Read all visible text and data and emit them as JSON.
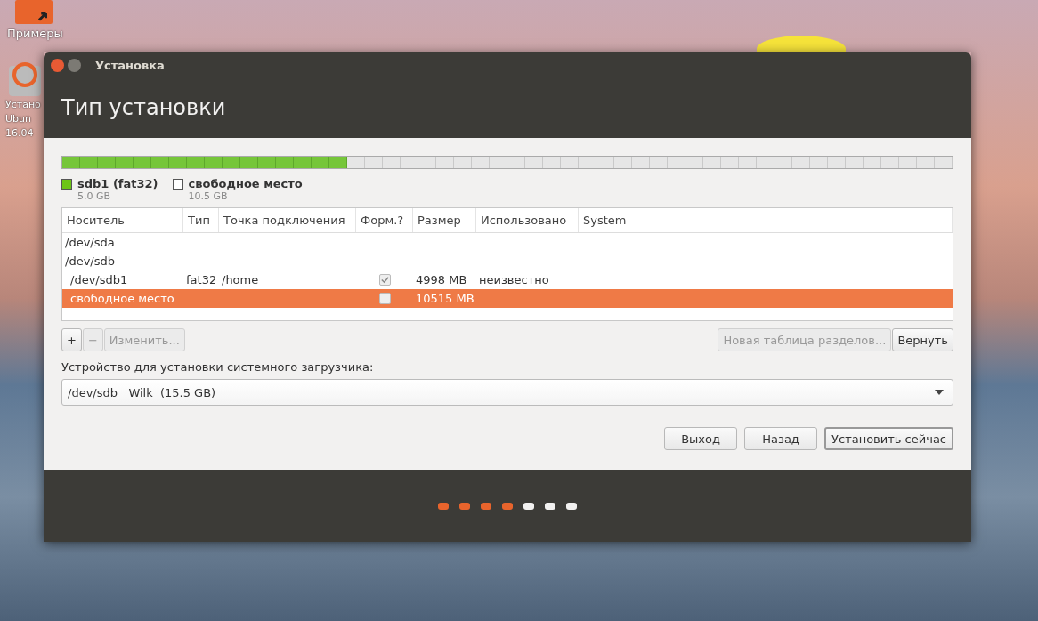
{
  "desktop_icons": [
    {
      "label": "Примеры",
      "kind": "folder"
    },
    {
      "label": "Устано",
      "kind": "installer"
    },
    {
      "label": "Ubun",
      "kind": "none"
    },
    {
      "label": "16.04",
      "kind": "none"
    }
  ],
  "window": {
    "title": "Установка",
    "heading": "Тип установки"
  },
  "partition_bar": {
    "level": 0.32
  },
  "legend": [
    {
      "name": "sdb1 (fat32)",
      "size": "5.0 GB",
      "kind": "used"
    },
    {
      "name": "свободное место",
      "size": "10.5 GB",
      "kind": "free"
    }
  ],
  "table": {
    "columns": [
      "Носитель",
      "Тип",
      "Точка подключения",
      "Форм.?",
      "Размер",
      "Использовано",
      "System"
    ],
    "rows": [
      {
        "device": "/dev/sda",
        "kind": "disk",
        "selected": false,
        "children": []
      },
      {
        "device": "/dev/sdb",
        "kind": "disk",
        "selected": false,
        "children": [
          {
            "device": "/dev/sdb1",
            "kind": "partition",
            "type": "fat32",
            "mount": "/home",
            "format": true,
            "size": "4998 MB",
            "used": "неизвестно",
            "selected": false
          },
          {
            "device": "свободное место",
            "kind": "partition",
            "format": false,
            "size": "10515 MB",
            "selected": true
          }
        ]
      }
    ]
  },
  "table_buttons": [
    {
      "label": "+",
      "disabled": false
    },
    {
      "label": "−",
      "disabled": true
    },
    {
      "label": "Изменить...",
      "disabled": true
    }
  ],
  "table_buttons_right": [
    {
      "label": "Новая таблица разделов...",
      "disabled": true
    },
    {
      "label": "Вернуть",
      "disabled": false
    }
  ],
  "bootloader": {
    "label": "Устройство для установки системного загрузчика:",
    "value": "/dev/sdb   Wilk  (15.5 GB)"
  },
  "footer_buttons": [
    {
      "label": "Выход",
      "default": false
    },
    {
      "label": "Назад",
      "default": false
    },
    {
      "label": "Установить сейчас",
      "default": true
    }
  ],
  "progress_dots": [
    {
      "done": true
    },
    {
      "done": true
    },
    {
      "done": true
    },
    {
      "done": true
    },
    {
      "done": false
    },
    {
      "done": false
    },
    {
      "done": false
    }
  ]
}
